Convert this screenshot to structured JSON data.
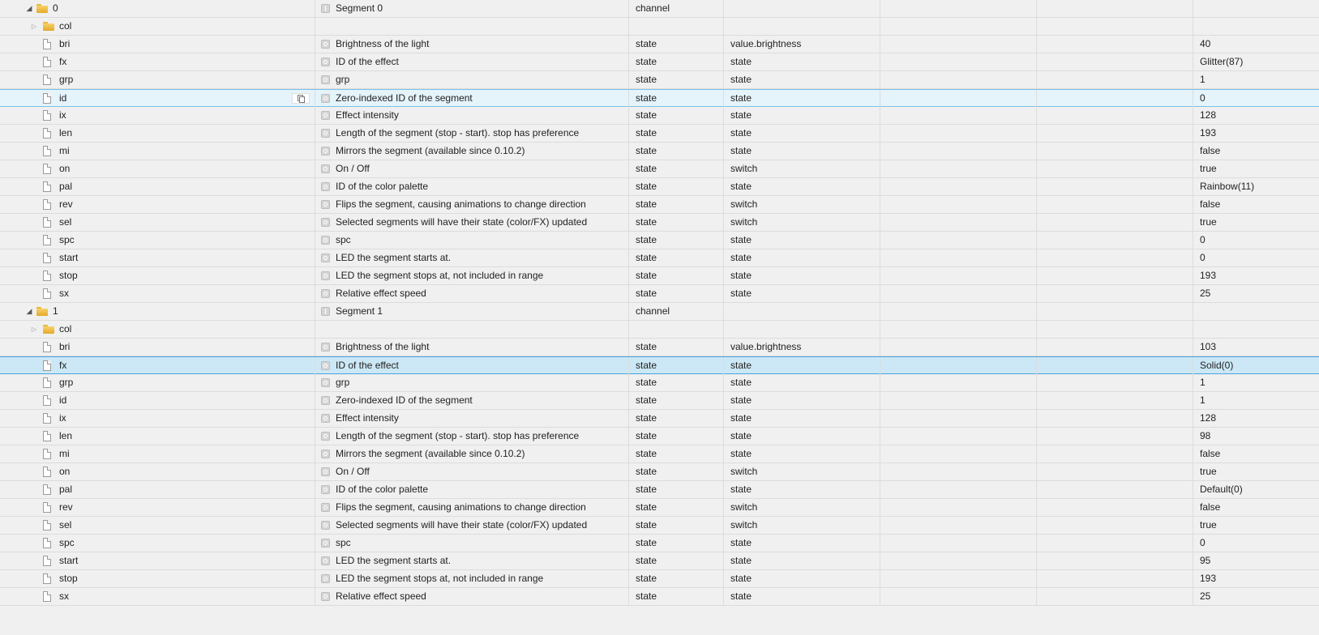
{
  "groups": [
    {
      "id": "0",
      "name": "Segment 0",
      "type": "channel",
      "folder": {
        "id": "col"
      },
      "states": [
        {
          "id": "bri",
          "name": "Brightness of the light",
          "type": "state",
          "role": "value.brightness",
          "value": "40"
        },
        {
          "id": "fx",
          "name": "ID of the effect",
          "type": "state",
          "role": "state",
          "value": "Glitter(87)"
        },
        {
          "id": "grp",
          "name": "grp",
          "type": "state",
          "role": "state",
          "value": "1"
        },
        {
          "id": "id",
          "name": "Zero-indexed ID of the segment",
          "type": "state",
          "role": "state",
          "value": "0",
          "highlight": "hover"
        },
        {
          "id": "ix",
          "name": "Effect intensity",
          "type": "state",
          "role": "state",
          "value": "128"
        },
        {
          "id": "len",
          "name": "Length of the segment (stop - start). stop has preference",
          "type": "state",
          "role": "state",
          "value": "193"
        },
        {
          "id": "mi",
          "name": "Mirrors the segment (available since 0.10.2)",
          "type": "state",
          "role": "state",
          "value": "false"
        },
        {
          "id": "on",
          "name": "On / Off",
          "type": "state",
          "role": "switch",
          "value": "true"
        },
        {
          "id": "pal",
          "name": "ID of the color palette",
          "type": "state",
          "role": "state",
          "value": "Rainbow(11)"
        },
        {
          "id": "rev",
          "name": "Flips the segment, causing animations to change direction",
          "type": "state",
          "role": "switch",
          "value": "false"
        },
        {
          "id": "sel",
          "name": "Selected segments will have their state (color/FX) updated",
          "type": "state",
          "role": "switch",
          "value": "true"
        },
        {
          "id": "spc",
          "name": "spc",
          "type": "state",
          "role": "state",
          "value": "0"
        },
        {
          "id": "start",
          "name": "LED the segment starts at.",
          "type": "state",
          "role": "state",
          "value": "0"
        },
        {
          "id": "stop",
          "name": "LED the segment stops at, not included in range",
          "type": "state",
          "role": "state",
          "value": "193"
        },
        {
          "id": "sx",
          "name": "Relative effect speed",
          "type": "state",
          "role": "state",
          "value": "25"
        }
      ]
    },
    {
      "id": "1",
      "name": "Segment 1",
      "type": "channel",
      "folder": {
        "id": "col"
      },
      "states": [
        {
          "id": "bri",
          "name": "Brightness of the light",
          "type": "state",
          "role": "value.brightness",
          "value": "103"
        },
        {
          "id": "fx",
          "name": "ID of the effect",
          "type": "state",
          "role": "state",
          "value": "Solid(0)",
          "highlight": "selected"
        },
        {
          "id": "grp",
          "name": "grp",
          "type": "state",
          "role": "state",
          "value": "1"
        },
        {
          "id": "id",
          "name": "Zero-indexed ID of the segment",
          "type": "state",
          "role": "state",
          "value": "1"
        },
        {
          "id": "ix",
          "name": "Effect intensity",
          "type": "state",
          "role": "state",
          "value": "128"
        },
        {
          "id": "len",
          "name": "Length of the segment (stop - start). stop has preference",
          "type": "state",
          "role": "state",
          "value": "98"
        },
        {
          "id": "mi",
          "name": "Mirrors the segment (available since 0.10.2)",
          "type": "state",
          "role": "state",
          "value": "false"
        },
        {
          "id": "on",
          "name": "On / Off",
          "type": "state",
          "role": "switch",
          "value": "true"
        },
        {
          "id": "pal",
          "name": "ID of the color palette",
          "type": "state",
          "role": "state",
          "value": "Default(0)"
        },
        {
          "id": "rev",
          "name": "Flips the segment, causing animations to change direction",
          "type": "state",
          "role": "switch",
          "value": "false"
        },
        {
          "id": "sel",
          "name": "Selected segments will have their state (color/FX) updated",
          "type": "state",
          "role": "switch",
          "value": "true"
        },
        {
          "id": "spc",
          "name": "spc",
          "type": "state",
          "role": "state",
          "value": "0"
        },
        {
          "id": "start",
          "name": "LED the segment starts at.",
          "type": "state",
          "role": "state",
          "value": "95"
        },
        {
          "id": "stop",
          "name": "LED the segment stops at, not included in range",
          "type": "state",
          "role": "state",
          "value": "193"
        },
        {
          "id": "sx",
          "name": "Relative effect speed",
          "type": "state",
          "role": "state",
          "value": "25"
        }
      ]
    }
  ]
}
